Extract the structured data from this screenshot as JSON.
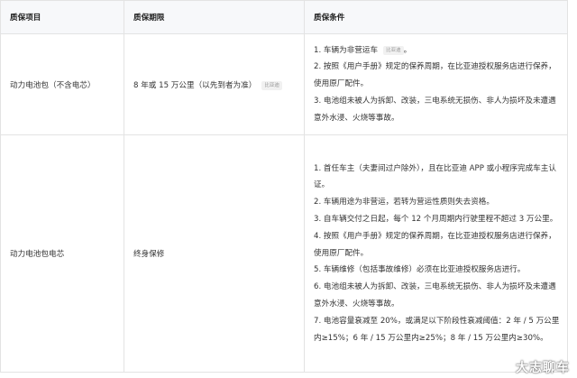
{
  "table": {
    "headers": [
      "质保项目",
      "质保期限",
      "质保条件"
    ],
    "rows": [
      {
        "item": "动力电池包（不含电芯）",
        "period": "8 年或 15 万公里（以先到者为准）",
        "period_tag": "比亚迪",
        "conditions": [
          "1. 车辆为非营运车",
          "2. 按照《用户手册》规定的保养周期，在比亚迪授权服务店进行保养，使用原厂配件。",
          "3. 电池组未被人为拆卸、改装，三电系统无损伤、非人为损坏及未遭遇意外水浸、火烧等事故。"
        ],
        "condition1_tag": "比亚迪",
        "condition1_suffix": "。"
      },
      {
        "item": "动力电池包电芯",
        "period": "终身保修",
        "conditions": [
          "1. 首任车主（夫妻间过户除外），且在比亚迪 APP 或小程序完成车主认证。",
          "2. 车辆用途为非营运，若转为营运性质则失去资格。",
          "3. 自车辆交付之日起，每个 12 个月周期内行驶里程不超过 3 万公里。",
          "4. 按照《用户手册》规定的保养周期，在比亚迪授权服务店进行保养，使用原厂配件。",
          "5. 车辆维修（包括事故维修）必须在比亚迪授权服务店进行。",
          "6. 电池组未被人为拆卸、改装，三电系统无损伤、非人为损坏及未遭遇意外水浸、火烧等事故。",
          "7. 电池容量衰减至 20%，或满足以下阶段性衰减阈值：2 年 / 5 万公里内≥15%；6 年 / 15 万公里内≥25%；8 年 / 15 万公里内≥30%。"
        ]
      }
    ]
  },
  "watermark": "大志聊车"
}
